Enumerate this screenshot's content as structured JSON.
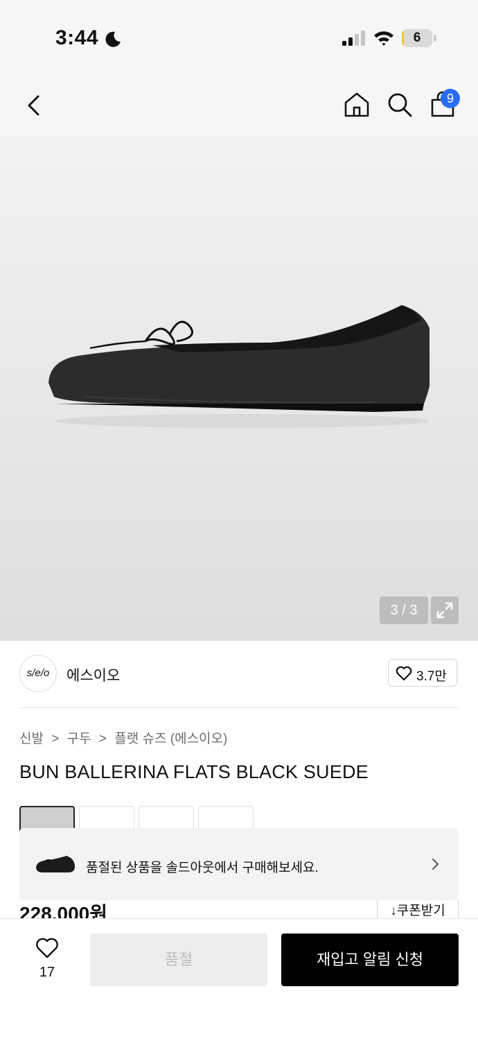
{
  "status_bar": {
    "time": "3:44",
    "battery_level": "6",
    "battery_percent": 6
  },
  "nav": {
    "back": "back-icon",
    "home": "home-icon",
    "search": "search-icon",
    "bag": "shopping-bag-icon",
    "bag_badge": "9"
  },
  "gallery": {
    "counter": "3 / 3",
    "expand": "expand-icon"
  },
  "brand": {
    "logo_text": "s/e/o",
    "name": "에스이오",
    "likes": "3.7만"
  },
  "breadcrumb": [
    "신발",
    "구두",
    "플랫 슈즈 (에스이오)"
  ],
  "breadcrumb_separator": ">",
  "product": {
    "title": "BUN BALLERINA FLATS BLACK SUEDE",
    "price": "228,000원",
    "coupon": "↓쿠폰받기"
  },
  "soldout_banner": {
    "text": "품절된 상품을 솔드아웃에서 구매해보세요."
  },
  "bottom_bar": {
    "wish_count": "17",
    "soldout_label": "품절",
    "restock_label": "재입고 알림 신청"
  },
  "colors": {
    "accent_badge": "#2a6df5",
    "battery_fill": "#f4c331",
    "primary_button": "#000000",
    "disabled_button": "#ededed"
  }
}
